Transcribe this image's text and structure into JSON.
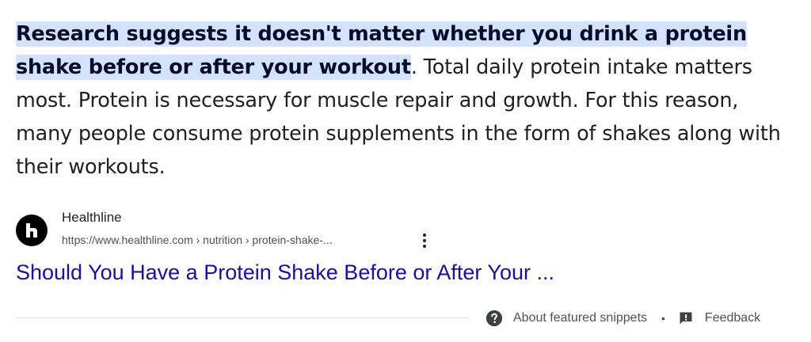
{
  "snippet": {
    "highlighted": "Research suggests it doesn't matter whether you drink a protein shake before or after your workout",
    "rest": ". Total daily protein intake matters most. Protein is necessary for muscle repair and growth. For this reason, many people consume protein supplements in the form of shakes along with their workouts."
  },
  "source": {
    "site_name": "Healthline",
    "breadcrumb": "https://www.healthline.com › nutrition › protein-shake-...",
    "favicon_icon": "healthline-logo-icon",
    "menu_icon": "more-vert-icon"
  },
  "result": {
    "title": "Should You Have a Protein Shake Before or After Your ..."
  },
  "footer": {
    "about_label": "About featured snippets",
    "separator": "•",
    "feedback_label": "Feedback",
    "about_icon": "help-circle-icon",
    "feedback_icon": "feedback-icon"
  },
  "colors": {
    "highlight_bg": "#d3e3fd",
    "link": "#1a0dab",
    "text": "#202124",
    "secondary_text": "#4d5156"
  }
}
